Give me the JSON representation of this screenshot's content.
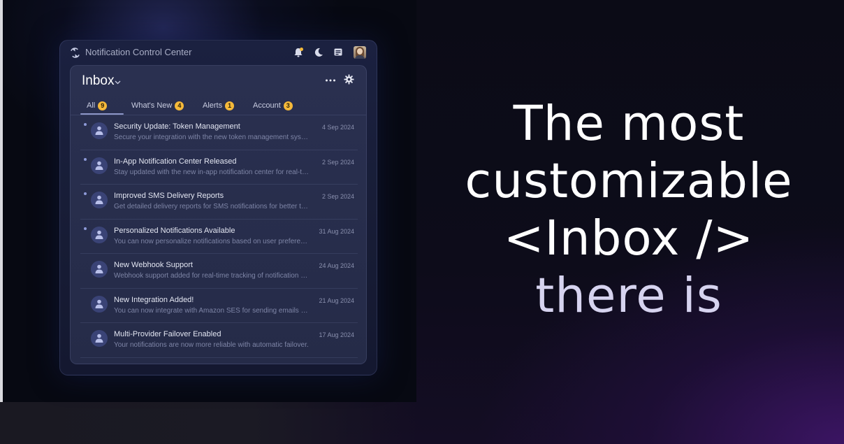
{
  "window": {
    "title": "Notification Control Center",
    "header_icons": [
      "bell-icon",
      "moon-icon",
      "message-icon",
      "user-avatar"
    ]
  },
  "inbox": {
    "title": "Inbox",
    "tabs": [
      {
        "label": "All",
        "count": "9"
      },
      {
        "label": "What's New",
        "count": "4"
      },
      {
        "label": "Alerts",
        "count": "1"
      },
      {
        "label": "Account",
        "count": "3"
      }
    ],
    "active_tab": "All",
    "notifications": [
      {
        "title": "Security Update: Token Management",
        "body": "Secure your integration with the new token management system.",
        "date": "4 Sep 2024",
        "unread": true
      },
      {
        "title": "In-App Notification Center Released",
        "body": "Stay updated with the new in-app notification center for real-time alerts.",
        "date": "2 Sep 2024",
        "unread": true
      },
      {
        "title": "Improved SMS Delivery Reports",
        "body": "Get detailed delivery reports for SMS notifications for better tracking.",
        "date": "2 Sep 2024",
        "unread": true
      },
      {
        "title": "Personalized Notifications Available",
        "body": "You can now personalize notifications based on user preferences.",
        "date": "31 Aug 2024",
        "unread": true
      },
      {
        "title": "New Webhook Support",
        "body": "Webhook support added for real-time tracking of notification events.",
        "date": "24 Aug 2024",
        "unread": false
      },
      {
        "title": "New Integration Added!",
        "body": "You can now integrate with Amazon SES for sending emails faster.",
        "date": "21 Aug 2024",
        "unread": false
      },
      {
        "title": "Multi-Provider Failover Enabled",
        "body": "Your notifications are now more reliable with automatic failover.",
        "date": "17 Aug 2024",
        "unread": false
      }
    ]
  },
  "headline": {
    "line1": "The most",
    "line2": "customizable",
    "line3": "<Inbox />",
    "line4": "there is"
  },
  "colors": {
    "badge": "#f5b93a",
    "accent": "#8d96c8",
    "headline": "#ffffff",
    "headline_muted": "#d6d3ef"
  }
}
